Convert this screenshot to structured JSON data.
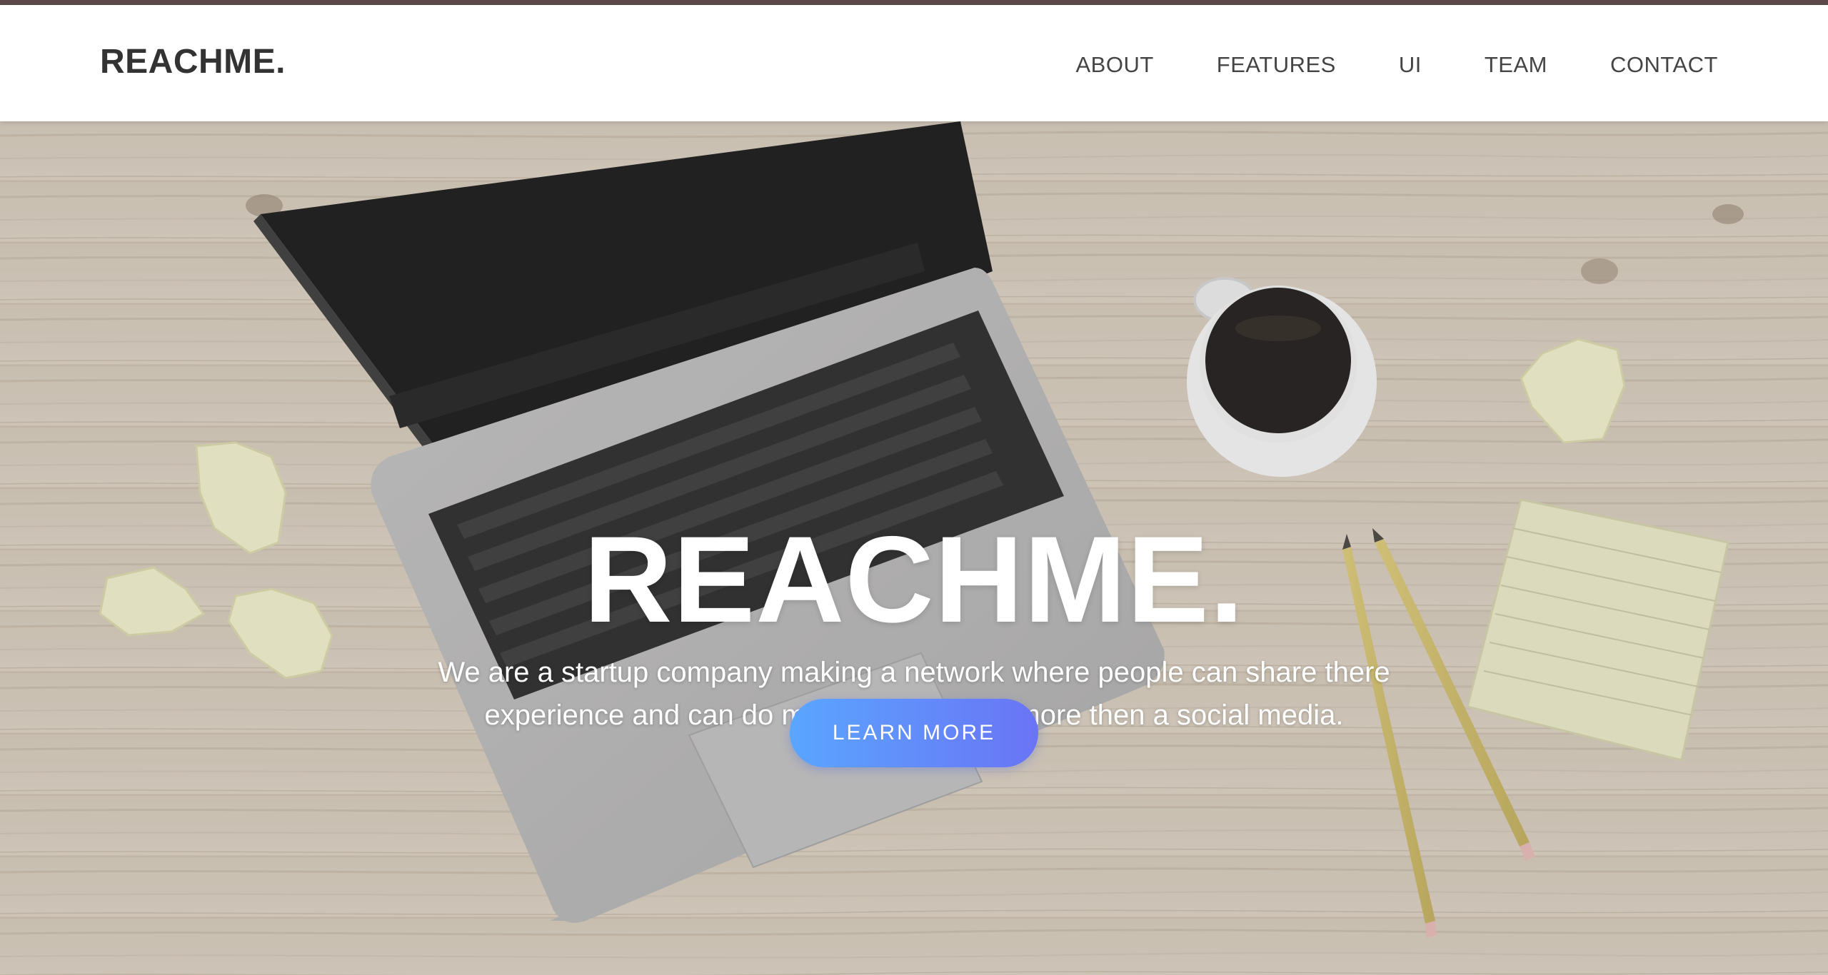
{
  "header": {
    "brand": "REACHME.",
    "nav": [
      {
        "label": "ABOUT"
      },
      {
        "label": "FEATURES"
      },
      {
        "label": "UI"
      },
      {
        "label": "TEAM"
      },
      {
        "label": "CONTACT"
      }
    ]
  },
  "hero": {
    "title": "REACHME.",
    "subtitle": "We are a startup company making a network where people can share there experience and can do many more things more then a social media.",
    "cta_label": "LEARN MORE"
  },
  "colors": {
    "accent_gradient_start": "#5aa6ff",
    "accent_gradient_end": "#6a74f5",
    "top_strip": "#5b4a49"
  },
  "icons": [
    "laptop-image",
    "coffee-cup-image",
    "pencil-image",
    "sticky-note-image",
    "crumpled-paper-image"
  ]
}
